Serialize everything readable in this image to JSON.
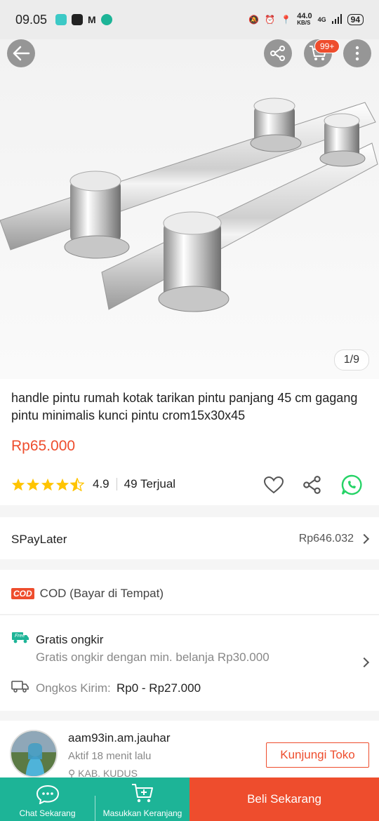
{
  "status_bar": {
    "time": "09.05",
    "net_speed": "44.0",
    "net_unit": "KB/S",
    "network": "4G",
    "battery": "94"
  },
  "hero": {
    "cart_badge": "99+",
    "pager": "1/9"
  },
  "product": {
    "title": "handle pintu rumah kotak tarikan pintu panjang 45 cm gagang pintu minimalis kunci pintu crom15x30x45",
    "price": "Rp65.000",
    "rating": "4.9",
    "sold": "49 Terjual",
    "rating_stars": 4.5
  },
  "spaylater": {
    "label": "SPayLater",
    "amount": "Rp646.032"
  },
  "cod": {
    "tag": "COD",
    "label": "COD (Bayar di Tempat)"
  },
  "shipping": {
    "free_tag": "Free",
    "title": "Gratis ongkir",
    "subtitle": "Gratis ongkir dengan min. belanja Rp30.000",
    "cost_label": "Ongkos Kirim:",
    "cost_value": "Rp0 - Rp27.000"
  },
  "shop": {
    "name": "aam93in.am.jauhar",
    "active": "Aktif 18 menit lalu",
    "location": "KAB. KUDUS",
    "visit_label": "Kunjungi Toko"
  },
  "bottom_bar": {
    "chat_label": "Chat Sekarang",
    "cart_label": "Masukkan Keranjang",
    "buy_label": "Beli Sekarang"
  },
  "colors": {
    "brand": "#ee4d2d",
    "teal": "#1db497",
    "star": "#ffc400",
    "whatsapp": "#25d366"
  }
}
